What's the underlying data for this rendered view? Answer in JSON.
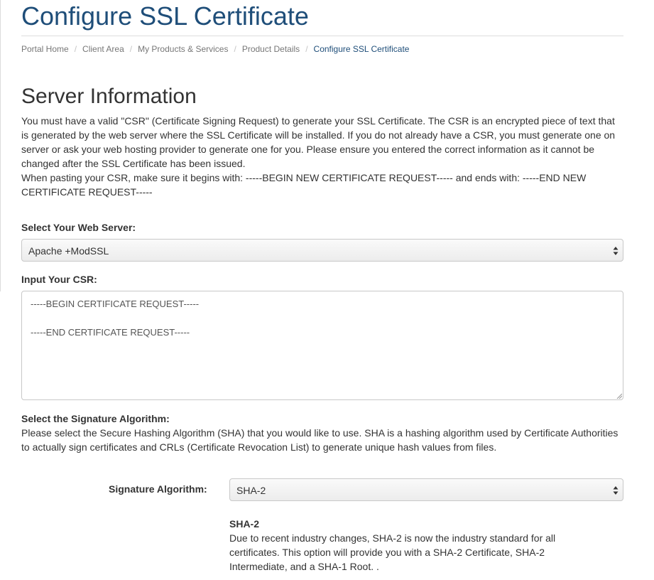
{
  "page": {
    "title": "Configure SSL Certificate"
  },
  "breadcrumb": [
    {
      "label": "Portal Home"
    },
    {
      "label": "Client Area"
    },
    {
      "label": "My Products & Services"
    },
    {
      "label": "Product Details"
    },
    {
      "label": "Configure SSL Certificate"
    }
  ],
  "server_info": {
    "heading": "Server Information",
    "description_1": "You must have a valid \"CSR\" (Certificate Signing Request) to generate your SSL Certificate. The CSR is an encrypted piece of text that is generated by the web server where the SSL Certificate will be installed. If you do not already have a CSR, you must generate one on server or ask your web hosting provider to generate one for you. Please ensure you entered the correct information as it cannot be changed after the SSL Certificate has been issued.",
    "description_2": "When pasting your CSR, make sure it begins with: -----BEGIN NEW CERTIFICATE REQUEST----- and ends with: -----END NEW CERTIFICATE REQUEST-----"
  },
  "web_server": {
    "label": "Select Your Web Server:",
    "selected": "Apache +ModSSL",
    "arrow_icon": "updown-arrows-icon"
  },
  "csr": {
    "label": "Input Your CSR:",
    "value": "-----BEGIN CERTIFICATE REQUEST-----\n\n-----END CERTIFICATE REQUEST-----"
  },
  "signature": {
    "section_label": "Select the Signature Algorithm:",
    "description": "Please select the Secure Hashing Algorithm (SHA) that you would like to use. SHA is a hashing algorithm used by Certificate Authorities to actually sign certificates and CRLs (Certificate Revocation List) to generate unique hash values from files.",
    "field_label": "Signature Algorithm:",
    "selected": "SHA-2",
    "info_title": "SHA-2",
    "info_text": "Due to recent industry changes, SHA-2 is now the industry standard for all certificates. This option will provide you with a SHA-2 Certificate, SHA-2 Intermediate, and a SHA-1 Root. ."
  },
  "colors": {
    "heading_blue": "#1f4e79",
    "text": "#333333",
    "muted": "#777777"
  }
}
